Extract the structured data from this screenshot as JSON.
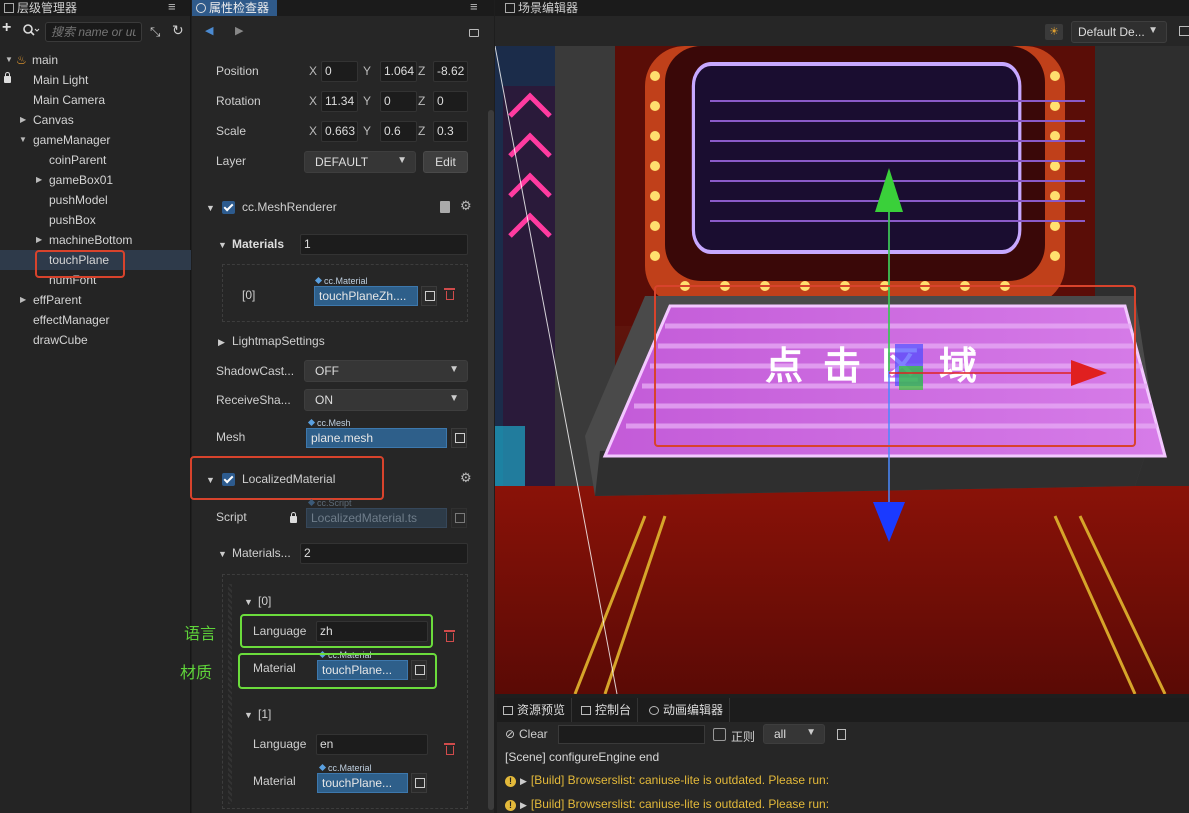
{
  "hierarchy": {
    "tab_title": "层级管理器",
    "search_placeholder": "搜索 name or uuid",
    "nodes": [
      {
        "label": "main"
      },
      {
        "label": "Main Light"
      },
      {
        "label": "Main Camera"
      },
      {
        "label": "Canvas"
      },
      {
        "label": "gameManager"
      },
      {
        "label": "coinParent"
      },
      {
        "label": "gameBox01"
      },
      {
        "label": "pushModel"
      },
      {
        "label": "pushBox"
      },
      {
        "label": "machineBottom"
      },
      {
        "label": "touchPlane"
      },
      {
        "label": "numFont"
      },
      {
        "label": "effParent"
      },
      {
        "label": "effectManager"
      },
      {
        "label": "drawCube"
      }
    ]
  },
  "inspector": {
    "tab_title": "属性检查器",
    "transform": {
      "position_label": "Position",
      "rotation_label": "Rotation",
      "scale_label": "Scale",
      "layer_label": "Layer",
      "axis_x": "X",
      "axis_y": "Y",
      "axis_z": "Z",
      "position": [
        "0",
        "1.064",
        "-8.62"
      ],
      "rotation": [
        "11.34",
        "0",
        "0"
      ],
      "scale": [
        "0.663",
        "0.6",
        "0.3"
      ],
      "layer_value": "DEFAULT",
      "edit_button": "Edit"
    },
    "mesh_renderer": {
      "title": "cc.MeshRenderer",
      "materials_label": "Materials",
      "materials_count": "1",
      "item_index": "[0]",
      "item_type": "cc.Material",
      "item_value": "touchPlaneZh....",
      "lightmap_label": "LightmapSettings",
      "shadow_cast_label": "ShadowCast...",
      "shadow_cast_value": "OFF",
      "receive_shadow_label": "ReceiveSha...",
      "receive_shadow_value": "ON",
      "mesh_label": "Mesh",
      "mesh_type": "cc.Mesh",
      "mesh_value": "plane.mesh"
    },
    "localized_material": {
      "title": "LocalizedMaterial",
      "script_label": "Script",
      "script_type": "cc.Script",
      "script_value": "LocalizedMaterial.ts",
      "materials_label": "Materials...",
      "materials_count": "2",
      "items": [
        {
          "index": "[0]",
          "language_label": "Language",
          "language_value": "zh",
          "material_label": "Material",
          "material_type": "cc.Material",
          "material_value": "touchPlane..."
        },
        {
          "index": "[1]",
          "language_label": "Language",
          "language_value": "en",
          "material_label": "Material",
          "material_type": "cc.Material",
          "material_value": "touchPlane..."
        }
      ]
    },
    "annotations": {
      "language": "语言",
      "material": "材质"
    }
  },
  "scene": {
    "tab_title": "场景编辑器",
    "camera_select": "Default De...",
    "board_text": "点击区域"
  },
  "console": {
    "tabs": [
      "资源预览",
      "控制台",
      "动画编辑器"
    ],
    "clear_button": "Clear",
    "regex_label": "正则",
    "filter_value": "all",
    "logs": [
      {
        "text": "[Scene] configureEngine end",
        "level": "info"
      },
      {
        "text": "[Build] Browserslist: caniuse-lite is outdated. Please run:",
        "level": "warn"
      },
      {
        "text": "[Build] Browserslist: caniuse-lite is outdated. Please run:",
        "level": "warn"
      }
    ]
  },
  "colors": {
    "accent": "#2f5a8a",
    "highlight_red": "#d8432c",
    "annotation_green": "#6bdc3c",
    "warn": "#e3b93a"
  }
}
